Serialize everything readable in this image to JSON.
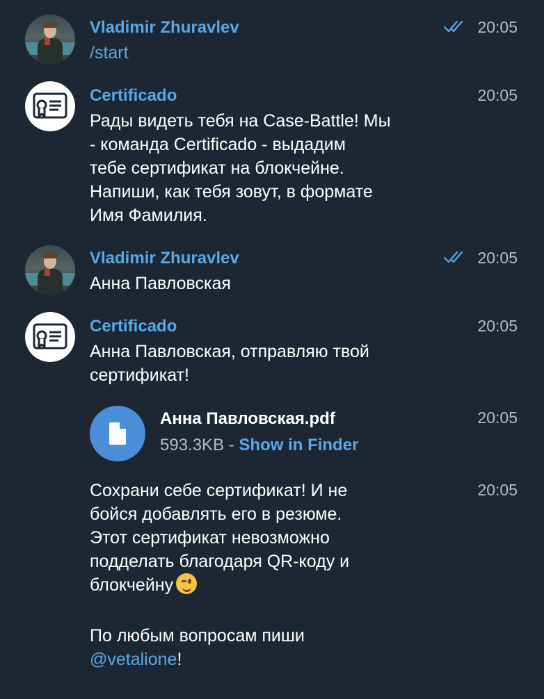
{
  "messages": [
    {
      "author": "Vladimir Zhuravlev",
      "time": "20:05",
      "status_icon": "double-check-icon",
      "text": "/start"
    },
    {
      "author": "Certificado",
      "time": "20:05",
      "text": "Рады видеть тебя на Case-Battle! Мы\n- команда Certificado - выдадим\nтебе сертификат на блокчейне.\nНапиши, как тебя зовут, в формате\nИмя Фамилия."
    },
    {
      "author": "Vladimir Zhuravlev",
      "time": "20:05",
      "status_icon": "double-check-icon",
      "text": "Анна Павловская"
    },
    {
      "author": "Certificado",
      "time": "20:05",
      "text": "Анна Павловская, отправляю твой\nсертификат!"
    },
    {
      "time": "20:05",
      "file": {
        "name": "Анна Павловская.pdf",
        "size": "593.3KB",
        "separator": " - ",
        "action": "Show in Finder",
        "icon": "document-icon"
      }
    },
    {
      "time": "20:05",
      "text": "Сохрани себе сертификат! И не\nбойся добавлять его в резюме.\nЭтот сертификат невозможно\nподделать благодаря QR-коду и\nблокчейну",
      "emoji": "winking-face-icon",
      "footer_text": "По любым вопросам пиши",
      "link": "@vetalione",
      "link_suffix": "!"
    }
  ],
  "colors": {
    "background": "#1d2733",
    "name": "#59a8e8",
    "text": "#ffffff",
    "time": "#b3bcc6",
    "file_icon": "#4a8fd8"
  }
}
